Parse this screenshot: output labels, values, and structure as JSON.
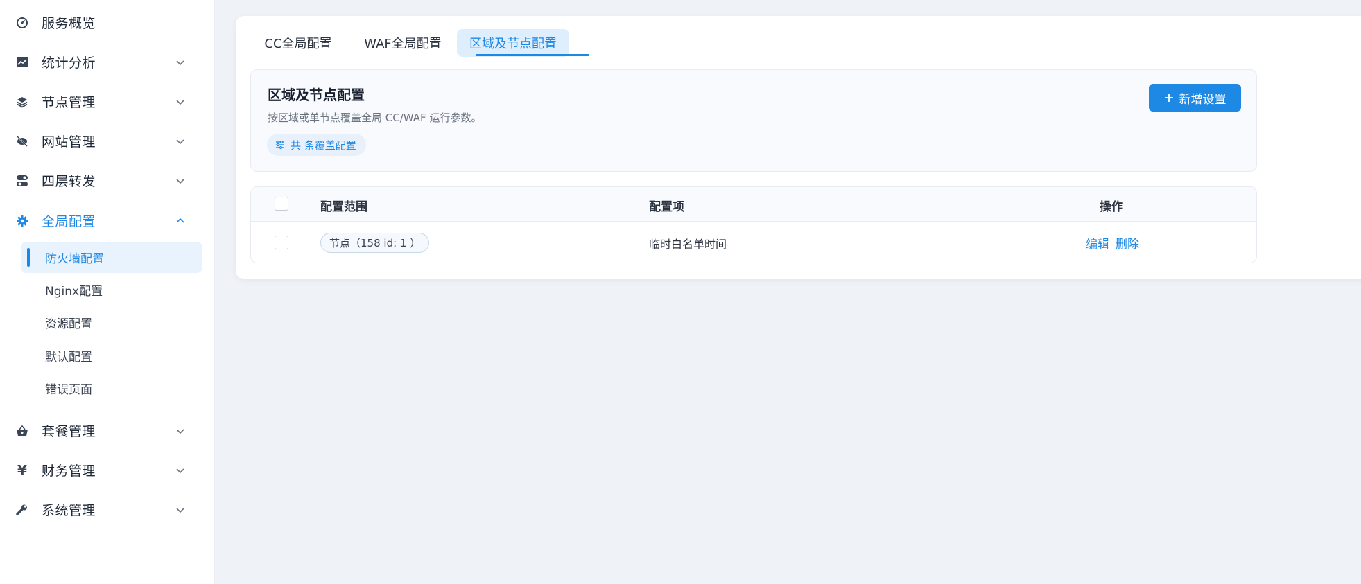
{
  "sidebar": {
    "items": [
      {
        "label": "服务概览"
      },
      {
        "label": "统计分析"
      },
      {
        "label": "节点管理"
      },
      {
        "label": "网站管理"
      },
      {
        "label": "四层转发"
      },
      {
        "label": "全局配置"
      },
      {
        "label": "套餐管理"
      },
      {
        "label": "财务管理"
      },
      {
        "label": "系统管理"
      }
    ],
    "sub_items": [
      {
        "label": "防火墙配置"
      },
      {
        "label": "Nginx配置"
      },
      {
        "label": "资源配置"
      },
      {
        "label": "默认配置"
      },
      {
        "label": "错误页面"
      }
    ]
  },
  "tabs": [
    {
      "label": "CC全局配置"
    },
    {
      "label": "WAF全局配置"
    },
    {
      "label": "区域及节点配置"
    }
  ],
  "panel": {
    "title": "区域及节点配置",
    "description": "按区域或单节点覆盖全局 CC/WAF 运行参数。",
    "count_label": "共 条覆盖配置",
    "add_button": "新增设置"
  },
  "table": {
    "headers": {
      "scope": "配置范围",
      "item": "配置项",
      "actions": "操作"
    },
    "rows": [
      {
        "scope": "节点（158 id: 1 ）",
        "item": "临时白名单时间",
        "edit": "编辑",
        "delete": "删除"
      }
    ]
  },
  "colors": {
    "accent": "#1e88e5",
    "background": "#eff2f7"
  }
}
